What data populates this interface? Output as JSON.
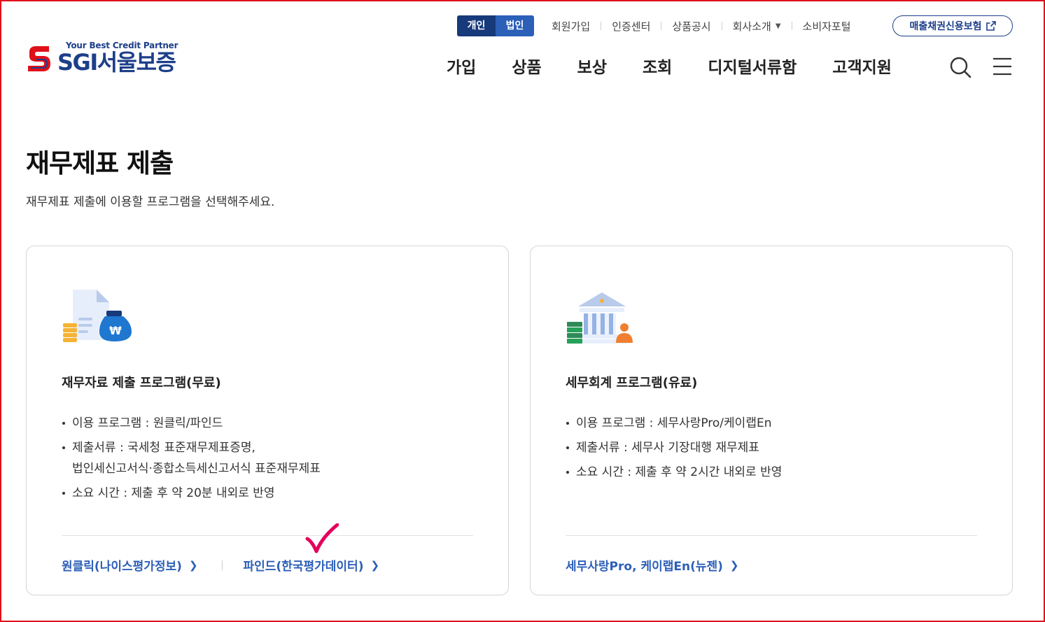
{
  "brand": {
    "tagline": "Your Best Credit Partner",
    "name": "SGI서울보증",
    "primary_color": "#1d3f8a",
    "accent_color": "#2b5fb8"
  },
  "header": {
    "toggle": {
      "personal": "개인",
      "corporate": "법인",
      "active": "개인"
    },
    "util_links": [
      "회원가입",
      "인증센터",
      "상품공시",
      "회사소개",
      "소비자포털"
    ],
    "sales_button": "매출채권신용보험",
    "nav": [
      "가입",
      "상품",
      "보상",
      "조회",
      "디지털서류함",
      "고객지원"
    ],
    "icons": {
      "search": "search-icon",
      "menu": "hamburger-menu-icon",
      "external": "external-link-icon"
    }
  },
  "page": {
    "title": "재무제표 제출",
    "description": "재무제표 제출에 이용할 프로그램을 선택해주세요."
  },
  "cards": [
    {
      "icon": "document-money-bag-icon",
      "title": "재무자료 제출 프로그램(무료)",
      "items": [
        "이용 프로그램 : 원클릭/파인드",
        "제출서류 : 국세청 표준재무제표증명,",
        "법인세신고서식·종합소득세신고서식 표준재무제표",
        "소요 시간 : 제출 후 약 20분 내외로 반영"
      ],
      "links": [
        "원클릭(나이스평가정보)",
        "파인드(한국평가데이터)"
      ]
    },
    {
      "icon": "bank-building-icon",
      "title": "세무회계 프로그램(유료)",
      "items": [
        "이용 프로그램 : 세무사랑Pro/케이랩En",
        "제출서류 : 세무사 기장대행 재무제표",
        "소요 시간 : 제출 후 약 2시간 내외로 반영"
      ],
      "links": [
        "세무사랑Pro, 케이랩En(뉴젠)"
      ]
    }
  ],
  "annotation": {
    "icon": "checkmark-icon",
    "color": "#e4005b"
  }
}
